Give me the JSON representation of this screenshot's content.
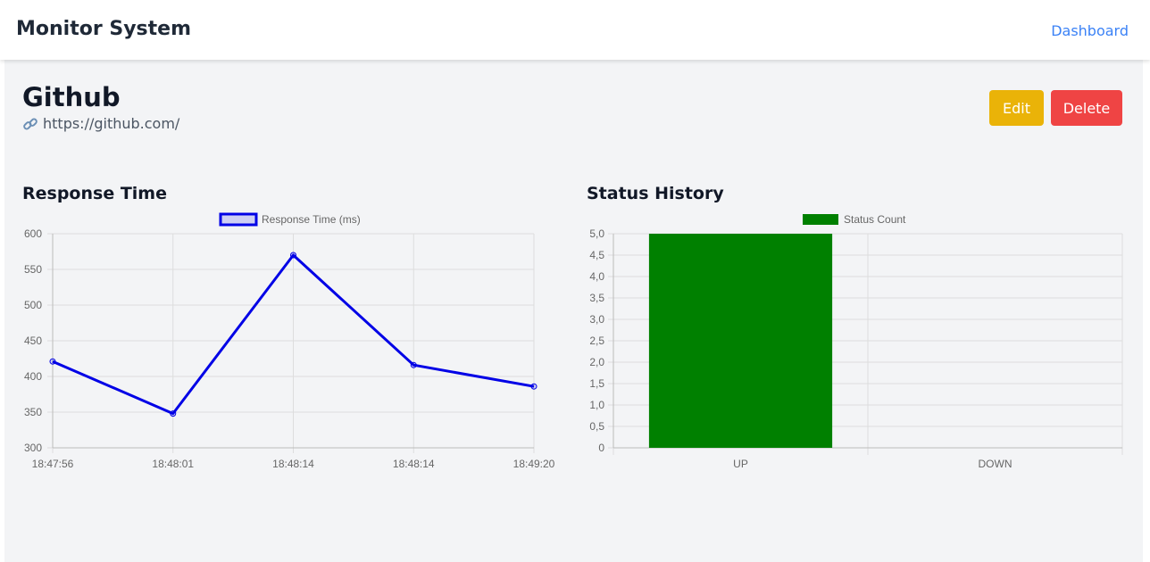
{
  "navbar": {
    "brand": "Monitor System",
    "link": "Dashboard"
  },
  "monitor": {
    "name": "Github",
    "url": "https://github.com/",
    "link_icon": "link-icon"
  },
  "actions": {
    "edit_label": "Edit",
    "delete_label": "Delete",
    "edit_color": "#eab308",
    "delete_color": "#ef4444"
  },
  "sections": {
    "response_title": "Response Time",
    "status_title": "Status History"
  },
  "chart_data": [
    {
      "type": "line",
      "legend_label": "Response Time (ms)",
      "x": [
        "18:47:56",
        "18:48:01",
        "18:48:14",
        "18:48:14",
        "18:49:20"
      ],
      "series": [
        {
          "name": "Response Time (ms)",
          "values": [
            421,
            348,
            570,
            416,
            386
          ],
          "color": "#0000e6"
        }
      ],
      "ylim": [
        300,
        600
      ],
      "yticks": [
        "600",
        "550",
        "500",
        "450",
        "400",
        "350",
        "300"
      ],
      "grid": true,
      "legend_position": "top"
    },
    {
      "type": "bar",
      "legend_label": "Status Count",
      "categories": [
        "UP",
        "DOWN"
      ],
      "series": [
        {
          "name": "Status Count",
          "values": [
            5,
            0
          ],
          "color": "#008000"
        }
      ],
      "ylim": [
        0,
        5
      ],
      "yticks": [
        "5,0",
        "4,5",
        "4,0",
        "3,5",
        "3,0",
        "2,5",
        "2,0",
        "1,5",
        "1,0",
        "0,5",
        "0"
      ],
      "grid": true,
      "legend_position": "top"
    }
  ]
}
